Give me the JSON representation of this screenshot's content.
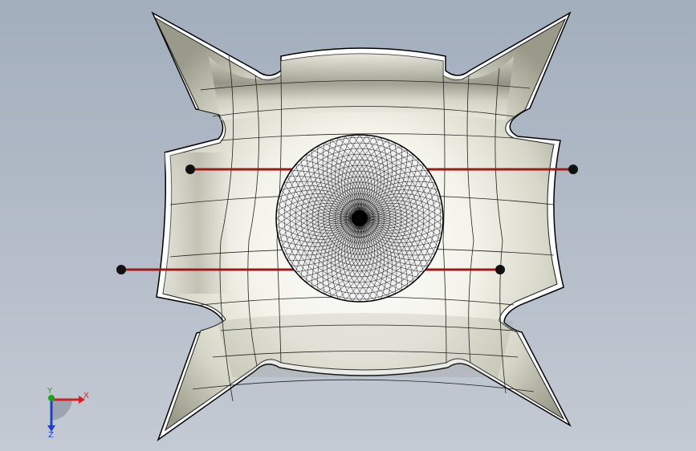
{
  "viewport": {
    "name": "3d-graphics-area",
    "background_top": "#a3aebd",
    "background_bottom": "#c4cad3"
  },
  "model": {
    "surface_color": "#e8e8dc",
    "edge_color": "#111111",
    "sphere_mesh_color": "#000000",
    "rod_color": "#a01818",
    "endpoint_color": "#111111"
  },
  "triad": {
    "x_label": "X",
    "y_label": "Y",
    "z_label": "Z",
    "x_color": "#d42020",
    "y_color": "#20a020",
    "z_color": "#2040c8"
  }
}
